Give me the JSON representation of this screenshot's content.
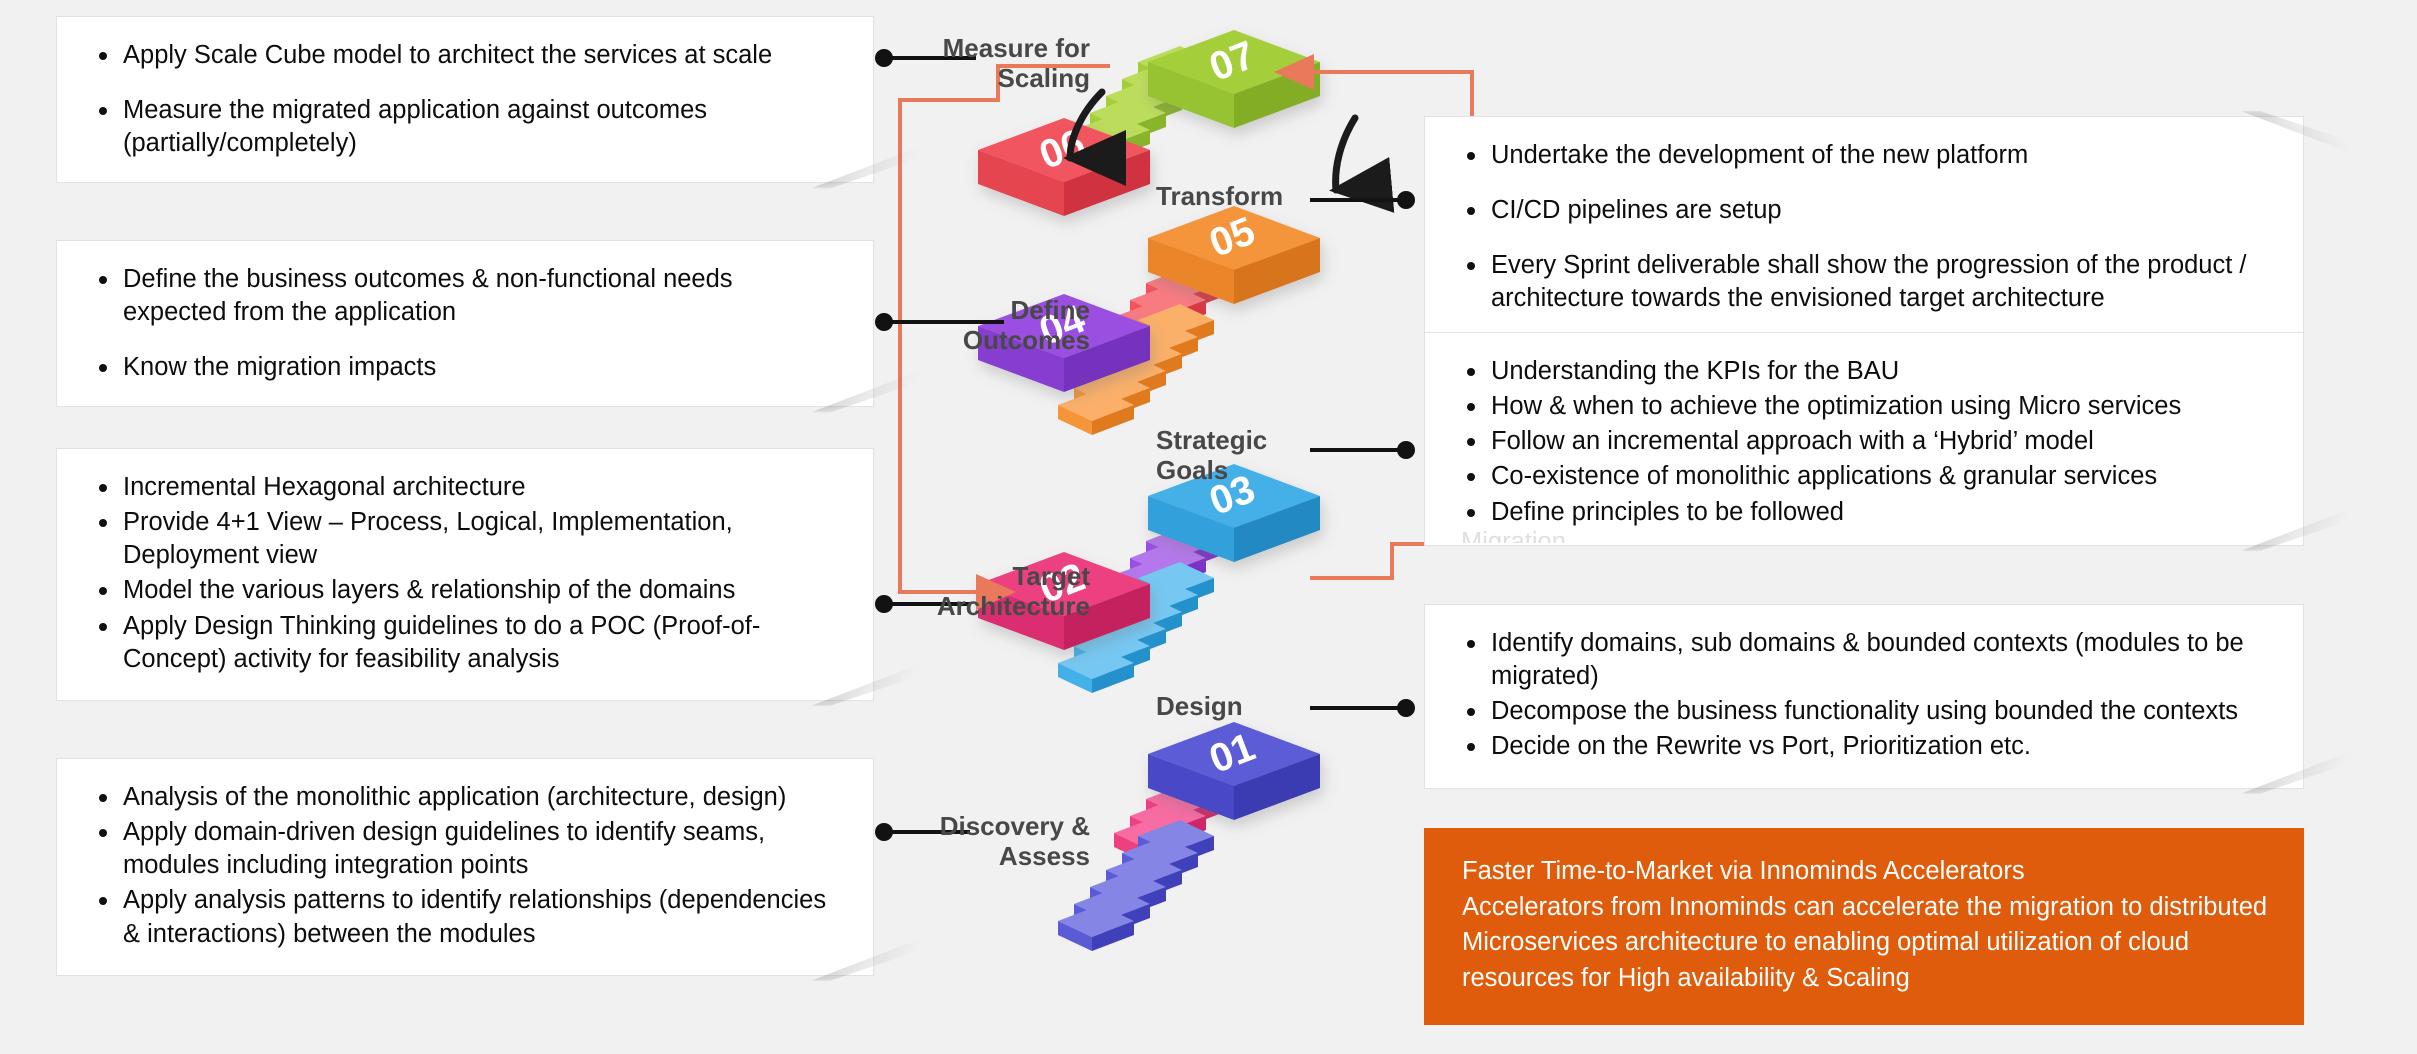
{
  "theme": {
    "background": "#f1f1f1",
    "card_background": "#ffffff",
    "card_border": "#e2e2e2",
    "text": "#0d0d0d",
    "label_text": "#484848",
    "leader_line": "#121212",
    "flow_arrow": "#e8795a",
    "accelerator_background": "#de5c0b",
    "accelerator_text": "#ffffff"
  },
  "stages": [
    {
      "number": "07",
      "label": "Measure for\nScaling",
      "color": "#a5ce3a",
      "color_dark": "#8ab42b"
    },
    {
      "number": "06",
      "label": "Transform",
      "color": "#f1555e",
      "color_dark": "#d93843"
    },
    {
      "number": "05",
      "label": "Define\nOutcomes",
      "color": "#f5953a",
      "color_dark": "#e07a1e"
    },
    {
      "number": "04",
      "label": "Strategic\nGoals",
      "color": "#9a4fe0",
      "color_dark": "#7e2fc9"
    },
    {
      "number": "03",
      "label": "Target\nArchitecture",
      "color": "#44b0e8",
      "color_dark": "#2591cc"
    },
    {
      "number": "02",
      "label": "Design",
      "color": "#ec4080",
      "color_dark": "#d12466"
    },
    {
      "number": "01",
      "label": "Discovery &\nAssess",
      "color": "#5b5bd6",
      "color_dark": "#4040bb"
    }
  ],
  "panels": {
    "measure_for_scaling": {
      "title": "Measure for Scaling",
      "bullets": [
        "Apply Scale Cube model to architect the services at scale",
        "Measure the migrated application against outcomes (partially/completely)"
      ]
    },
    "define_outcomes": {
      "title": "Define Outcomes",
      "bullets": [
        "Define the business outcomes & non-functional needs expected from the application",
        "Know the migration impacts"
      ]
    },
    "target_architecture": {
      "title": "Target Architecture",
      "bullets": [
        "Incremental Hexagonal architecture",
        "Provide 4+1 View – Process, Logical, Implementation, Deployment view",
        "Model the various layers & relationship of the domains",
        "Apply Design Thinking guidelines to do a POC (Proof-of-Concept) activity for feasibility analysis"
      ]
    },
    "discovery_assess": {
      "title": "Discovery & Assess",
      "bullets": [
        "Analysis of the monolithic application (architecture, design)",
        "Apply domain-driven design guidelines to identify seams, modules including integration points",
        "Apply analysis patterns to identify relationships (dependencies & interactions) between the modules"
      ]
    },
    "transform": {
      "title": "Transform",
      "bullets": [
        "Undertake the development of the new platform",
        "CI/CD pipelines are setup",
        "Every Sprint deliverable shall show the progression of the product / architecture towards the envisioned target architecture"
      ]
    },
    "strategic_goals": {
      "title": "Strategic Goals",
      "bullets": [
        "Understanding the KPIs for the BAU",
        "How & when to achieve the optimization using Micro services",
        "Follow an incremental approach with a ‘Hybrid’ model",
        "Co-existence of monolithic applications & granular services",
        "Define principles to be followed"
      ],
      "clipped_text": "Migration"
    },
    "design": {
      "title": "Design",
      "bullets": [
        "Identify domains, sub domains & bounded contexts (modules to be migrated)",
        "Decompose the business functionality using bounded the contexts",
        "Decide on the Rewrite vs Port, Prioritization etc."
      ]
    }
  },
  "accelerator": {
    "heading": "Faster Time-to-Market via Innominds Accelerators",
    "body": "Accelerators from Innominds can accelerate the migration to distributed Microservices architecture to enabling optimal utilization of cloud resources for High availability & Scaling"
  }
}
